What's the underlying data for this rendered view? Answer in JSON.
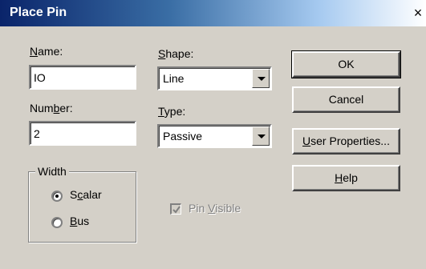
{
  "window": {
    "title": "Place Pin",
    "close_glyph": "×"
  },
  "fields": {
    "name": {
      "label_mnemonic": "N",
      "label_rest": "ame:",
      "value": "IO"
    },
    "number": {
      "label_before": "Num",
      "label_mnemonic": "b",
      "label_rest": "er:",
      "value": "2"
    },
    "shape": {
      "label_mnemonic": "S",
      "label_rest": "hape:",
      "value": "Line"
    },
    "type": {
      "label_mnemonic": "T",
      "label_rest": "ype:",
      "value": "Passive"
    }
  },
  "width_group": {
    "title": "Width",
    "scalar": {
      "label_before": "S",
      "label_mnemonic": "c",
      "label_rest": "alar",
      "checked": true
    },
    "bus": {
      "label_mnemonic": "B",
      "label_rest": "us",
      "checked": false
    }
  },
  "pin_visible": {
    "label_before": "Pin ",
    "label_mnemonic": "V",
    "label_rest": "isible",
    "checked": true,
    "enabled": false
  },
  "buttons": {
    "ok": "OK",
    "cancel": "Cancel",
    "user_properties": {
      "mnemonic": "U",
      "rest": "ser Properties..."
    },
    "help": {
      "mnemonic": "H",
      "rest": "elp"
    }
  }
}
